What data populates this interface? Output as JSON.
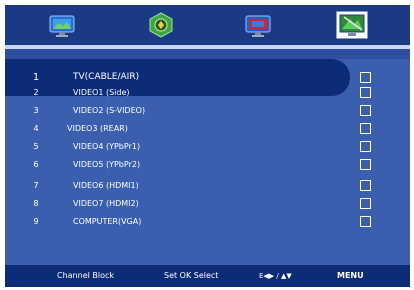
{
  "menu_tabs": [
    {
      "icon": "tv-picture-icon"
    },
    {
      "icon": "audio-gear-icon"
    },
    {
      "icon": "tv-channel-icon"
    },
    {
      "icon": "settings-screen-icon",
      "active": true
    }
  ],
  "list": {
    "items": [
      {
        "num": "1",
        "label": "TV(CABLE/AIR)",
        "selected": true
      },
      {
        "num": "2",
        "label": "VIDEO1 (Side)"
      },
      {
        "num": "3",
        "label": "VIDEO2 (S-VIDEO)"
      },
      {
        "num": "4",
        "label": "VIDEO3 (REAR)"
      },
      {
        "num": "5",
        "label": "VIDEO4 (YPbPr1)"
      },
      {
        "num": "6",
        "label": "VIDEO5 (YPbPr2)"
      },
      {
        "num": "7",
        "label": "VIDEO6 (HDMI1)"
      },
      {
        "num": "8",
        "label": "VIDEO7 (HDMI2)"
      },
      {
        "num": "9",
        "label": "COMPUTER(VGA)"
      }
    ]
  },
  "footer": {
    "channel_block": "Channel Block",
    "set_select": "Set  OK  Select",
    "nav_hint": "E◀▶ / ▲▼",
    "menu": "MENU"
  },
  "colors": {
    "panel": "#3a5fae",
    "bars": "#0d2c78",
    "top_bar": "#1a3a86"
  }
}
